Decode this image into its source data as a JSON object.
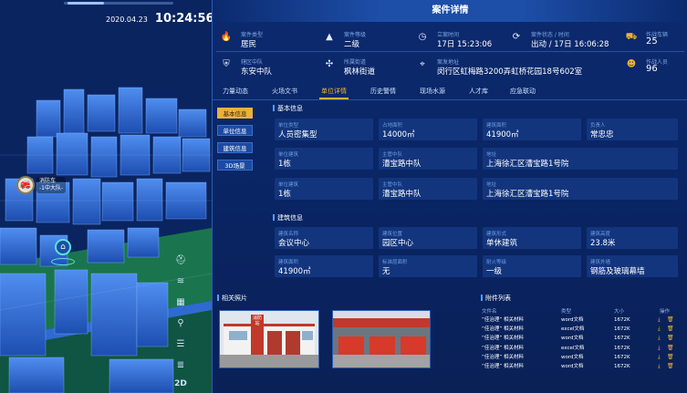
{
  "datetime": {
    "date": "2020.04.23",
    "time": "10:24:56"
  },
  "map": {
    "truck_label_1": "消防车",
    "truck_label_2": "-1中大队-",
    "truck_icon": "fire-truck-icon",
    "pin_icon": "location-pin-icon",
    "tools": [
      "fire-station-icon",
      "layers-icon",
      "building-icon",
      "hydrant-icon",
      "road-icon",
      "list-icon"
    ],
    "mode_label": "2D"
  },
  "panel": {
    "title": "案件详情",
    "info": [
      {
        "label": "案件类型",
        "value": "居民",
        "icon": "fire-icon"
      },
      {
        "label": "案件等级",
        "value": "二级",
        "icon": "warning-icon"
      },
      {
        "label": "立案时间",
        "value": "17日 15:23:06",
        "icon": "clock-icon"
      },
      {
        "label": "案件状态 / 时间",
        "value": "出动 / 17日 16:06:28",
        "icon": "status-icon"
      },
      {
        "label": "作战车辆",
        "value": "25",
        "icon": "truck-icon"
      },
      {
        "label": "辖区中队",
        "value": "东安中队",
        "icon": "shield-icon"
      },
      {
        "label": "所属街道",
        "value": "枫林街道",
        "icon": "street-icon"
      },
      {
        "label": "案发地址",
        "value": "闵行区虹梅路3200弄虹桥花园18号602室",
        "icon": "location-icon"
      },
      {
        "label": "作战人员",
        "value": "96",
        "icon": "person-icon"
      }
    ],
    "tabs": [
      "力量动态",
      "火场文书",
      "单位详情",
      "历史警情",
      "现场水源",
      "人才库",
      "应急联动"
    ],
    "active_tab": "单位详情",
    "subnav": [
      "基本信息",
      "单位信息",
      "建筑信息",
      "3D场景"
    ],
    "basic": {
      "title": "基本信息",
      "cells": [
        {
          "label": "单位类型",
          "value": "人员密集型"
        },
        {
          "label": "占地面积",
          "value": "14000㎡"
        },
        {
          "label": "建筑面积",
          "value": "41900㎡"
        },
        {
          "label": "负责人",
          "value": "常忠忠"
        },
        {
          "label": "单位建筑",
          "value": "1栋"
        },
        {
          "label": "主管中队",
          "value": "漕宝路中队"
        },
        {
          "label": "地址",
          "value": "上海徐汇区漕宝路1号院"
        },
        {
          "label": "单位建筑",
          "value": "1栋"
        },
        {
          "label": "主管中队",
          "value": "漕宝路中队"
        },
        {
          "label": "地址",
          "value": "上海徐汇区漕宝路1号院"
        }
      ]
    },
    "building": {
      "title": "建筑信息",
      "cells": [
        {
          "label": "建筑名称",
          "value": "会议中心"
        },
        {
          "label": "建筑位置",
          "value": "园区中心"
        },
        {
          "label": "建筑形式",
          "value": "单休建筑"
        },
        {
          "label": "建筑高度",
          "value": "23.8米"
        },
        {
          "label": "建筑面积",
          "value": "41900㎡"
        },
        {
          "label": "标准层面积",
          "value": "无"
        },
        {
          "label": "耐火等级",
          "value": "一级"
        },
        {
          "label": "建筑外墙",
          "value": "钢筋及玻璃幕墙"
        }
      ]
    },
    "photos": {
      "title": "相关照片",
      "sign": "消防站"
    },
    "attachments": {
      "title": "附件列表",
      "headers": [
        "文件名",
        "类型",
        "大小",
        "操作"
      ],
      "rows": [
        {
          "name": "“佳治理” 相关材料",
          "type": "word文档",
          "size": "1672K"
        },
        {
          "name": "“佳治理” 相关材料",
          "type": "excel文档",
          "size": "1672K"
        },
        {
          "name": "“佳治理” 相关材料",
          "type": "word文档",
          "size": "1672K"
        },
        {
          "name": "“佳治理” 相关材料",
          "type": "excel文档",
          "size": "1672K"
        },
        {
          "name": "“佳治理” 相关材料",
          "type": "word文档",
          "size": "1672K"
        },
        {
          "name": "“佳治理” 相关材料",
          "type": "word文档",
          "size": "1672K"
        }
      ],
      "op_icons": [
        "download-icon",
        "delete-icon"
      ]
    }
  },
  "colors": {
    "accent": "#f2b233",
    "panel": "#0b2a6e",
    "label": "#7fa8e6"
  }
}
